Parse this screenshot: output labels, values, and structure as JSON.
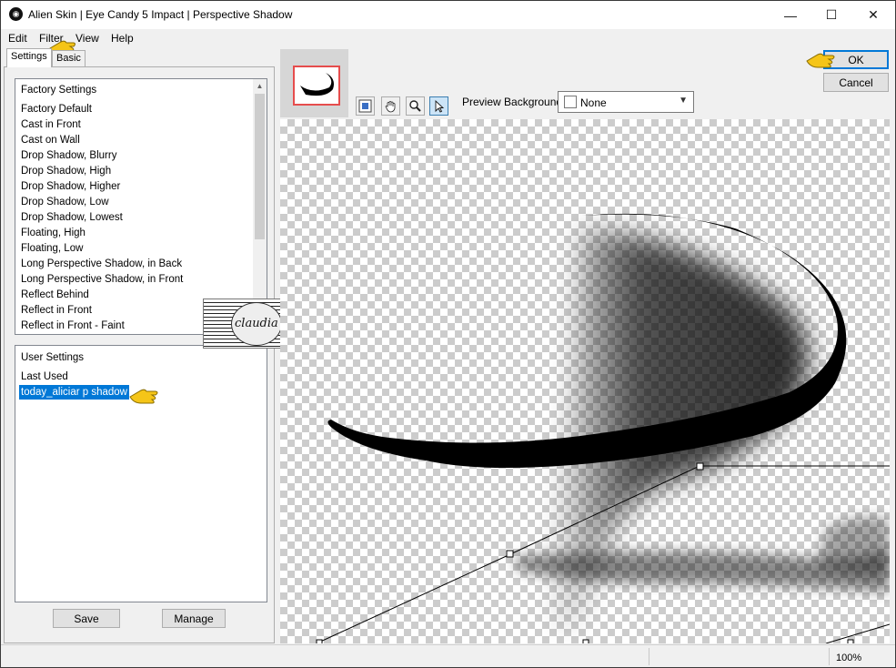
{
  "window": {
    "title": "Alien Skin | Eye Candy 5 Impact | Perspective Shadow",
    "minimize_glyph": "—",
    "maximize_glyph": "☐",
    "close_glyph": "✕"
  },
  "menu": {
    "edit": "Edit",
    "filter": "Filter",
    "view": "View",
    "help": "Help"
  },
  "tabs": {
    "settings": "Settings",
    "basic": "Basic"
  },
  "factory_settings": {
    "header": "Factory Settings",
    "items": [
      "Factory Default",
      "Cast in Front",
      "Cast on Wall",
      "Drop Shadow, Blurry",
      "Drop Shadow, High",
      "Drop Shadow, Higher",
      "Drop Shadow, Low",
      "Drop Shadow, Lowest",
      "Floating, High",
      "Floating, Low",
      "Long Perspective Shadow, in Back",
      "Long Perspective Shadow, in Front",
      "Reflect Behind",
      "Reflect in Front",
      "Reflect in Front - Faint"
    ]
  },
  "user_settings": {
    "header": "User Settings",
    "items": [
      "Last Used",
      "today_aliciar p shadow"
    ],
    "selected": "today_aliciar p shadow"
  },
  "buttons": {
    "save": "Save",
    "manage": "Manage",
    "ok": "OK",
    "cancel": "Cancel"
  },
  "preview": {
    "background_label": "Preview Background:",
    "background_value": "None"
  },
  "watermark": {
    "text": "claudia"
  },
  "status": {
    "zoom": "100%"
  },
  "icons": [
    "app-logo-icon",
    "preview-toggle-icon",
    "hand-tool-icon",
    "zoom-tool-icon",
    "select-arrow-icon",
    "dropdown-chevron-icon",
    "pointing-hand-icon"
  ],
  "colors": {
    "selection": "#0078d7",
    "pointer_hand": "#f5c518",
    "thumbnail_border": "#e64d4d"
  }
}
